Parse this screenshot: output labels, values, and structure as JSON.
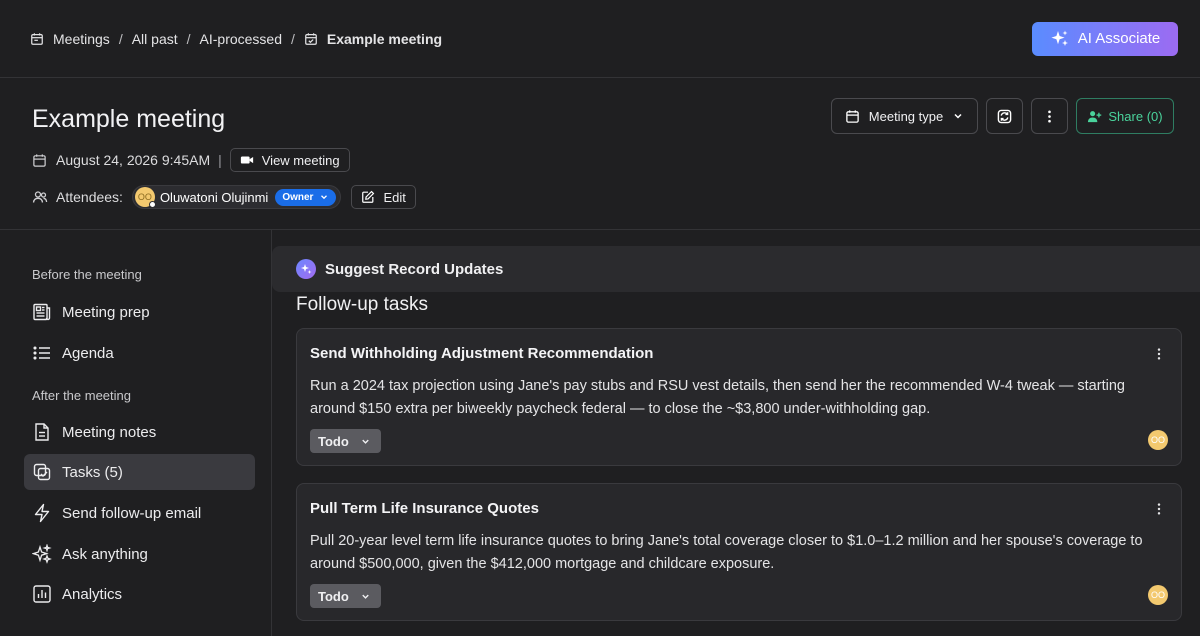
{
  "breadcrumb": {
    "items": [
      {
        "label": "Meetings",
        "icon": "calendar-icon"
      },
      {
        "label": "All past"
      },
      {
        "label": "AI-processed"
      },
      {
        "label": "Example meeting",
        "icon": "calendar-check-icon"
      }
    ],
    "separator": "/"
  },
  "ai_button": {
    "label": "AI Associate",
    "icon": "sparkles-icon",
    "gradient": [
      "#5a8cff",
      "#9c6bf2"
    ]
  },
  "meeting": {
    "title": "Example meeting",
    "datetime": "August 24, 2026 9:45AM",
    "view_meeting_label": "View meeting",
    "attendees_label": "Attendees:",
    "attendee_name": "Oluwatoni Olujinmi",
    "attendee_initials": "OO",
    "attendee_role": "Owner",
    "edit_label": "Edit"
  },
  "header_actions": {
    "meeting_type_label": "Meeting type",
    "share_label": "Share (0)",
    "share_color": "#4ad39c"
  },
  "sidebar": {
    "before_label": "Before the meeting",
    "after_label": "After the meeting",
    "before_items": [
      {
        "label": "Meeting prep",
        "icon": "newspaper-icon"
      },
      {
        "label": "Agenda",
        "icon": "list-icon"
      }
    ],
    "after_items": [
      {
        "label": "Meeting notes",
        "icon": "document-icon"
      },
      {
        "label": "Tasks (5)",
        "icon": "tasks-icon",
        "active": true
      },
      {
        "label": "Send follow-up email",
        "icon": "lightning-icon"
      },
      {
        "label": "Ask anything",
        "icon": "sparkles-icon"
      },
      {
        "label": "Analytics",
        "icon": "bar-chart-icon"
      }
    ]
  },
  "main": {
    "suggest_label": "Suggest Record Updates",
    "section_title": "Follow-up tasks",
    "tasks": [
      {
        "title": "Send Withholding Adjustment Recommendation",
        "body": "Run a 2024 tax projection using Jane's pay stubs and RSU vest details, then send her the recommended W-4 tweak — starting around $150 extra per biweekly paycheck federal — to close the ~$3,800 under-withholding gap.",
        "status": "Todo",
        "assignee_initials": "OO"
      },
      {
        "title": "Pull Term Life Insurance Quotes",
        "body": "Pull 20-year level term life insurance quotes to bring Jane's total coverage closer to $1.0–1.2 million and her spouse's coverage to around $500,000, given the $412,000 mortgage and childcare exposure.",
        "status": "Todo",
        "assignee_initials": "OO"
      }
    ]
  }
}
